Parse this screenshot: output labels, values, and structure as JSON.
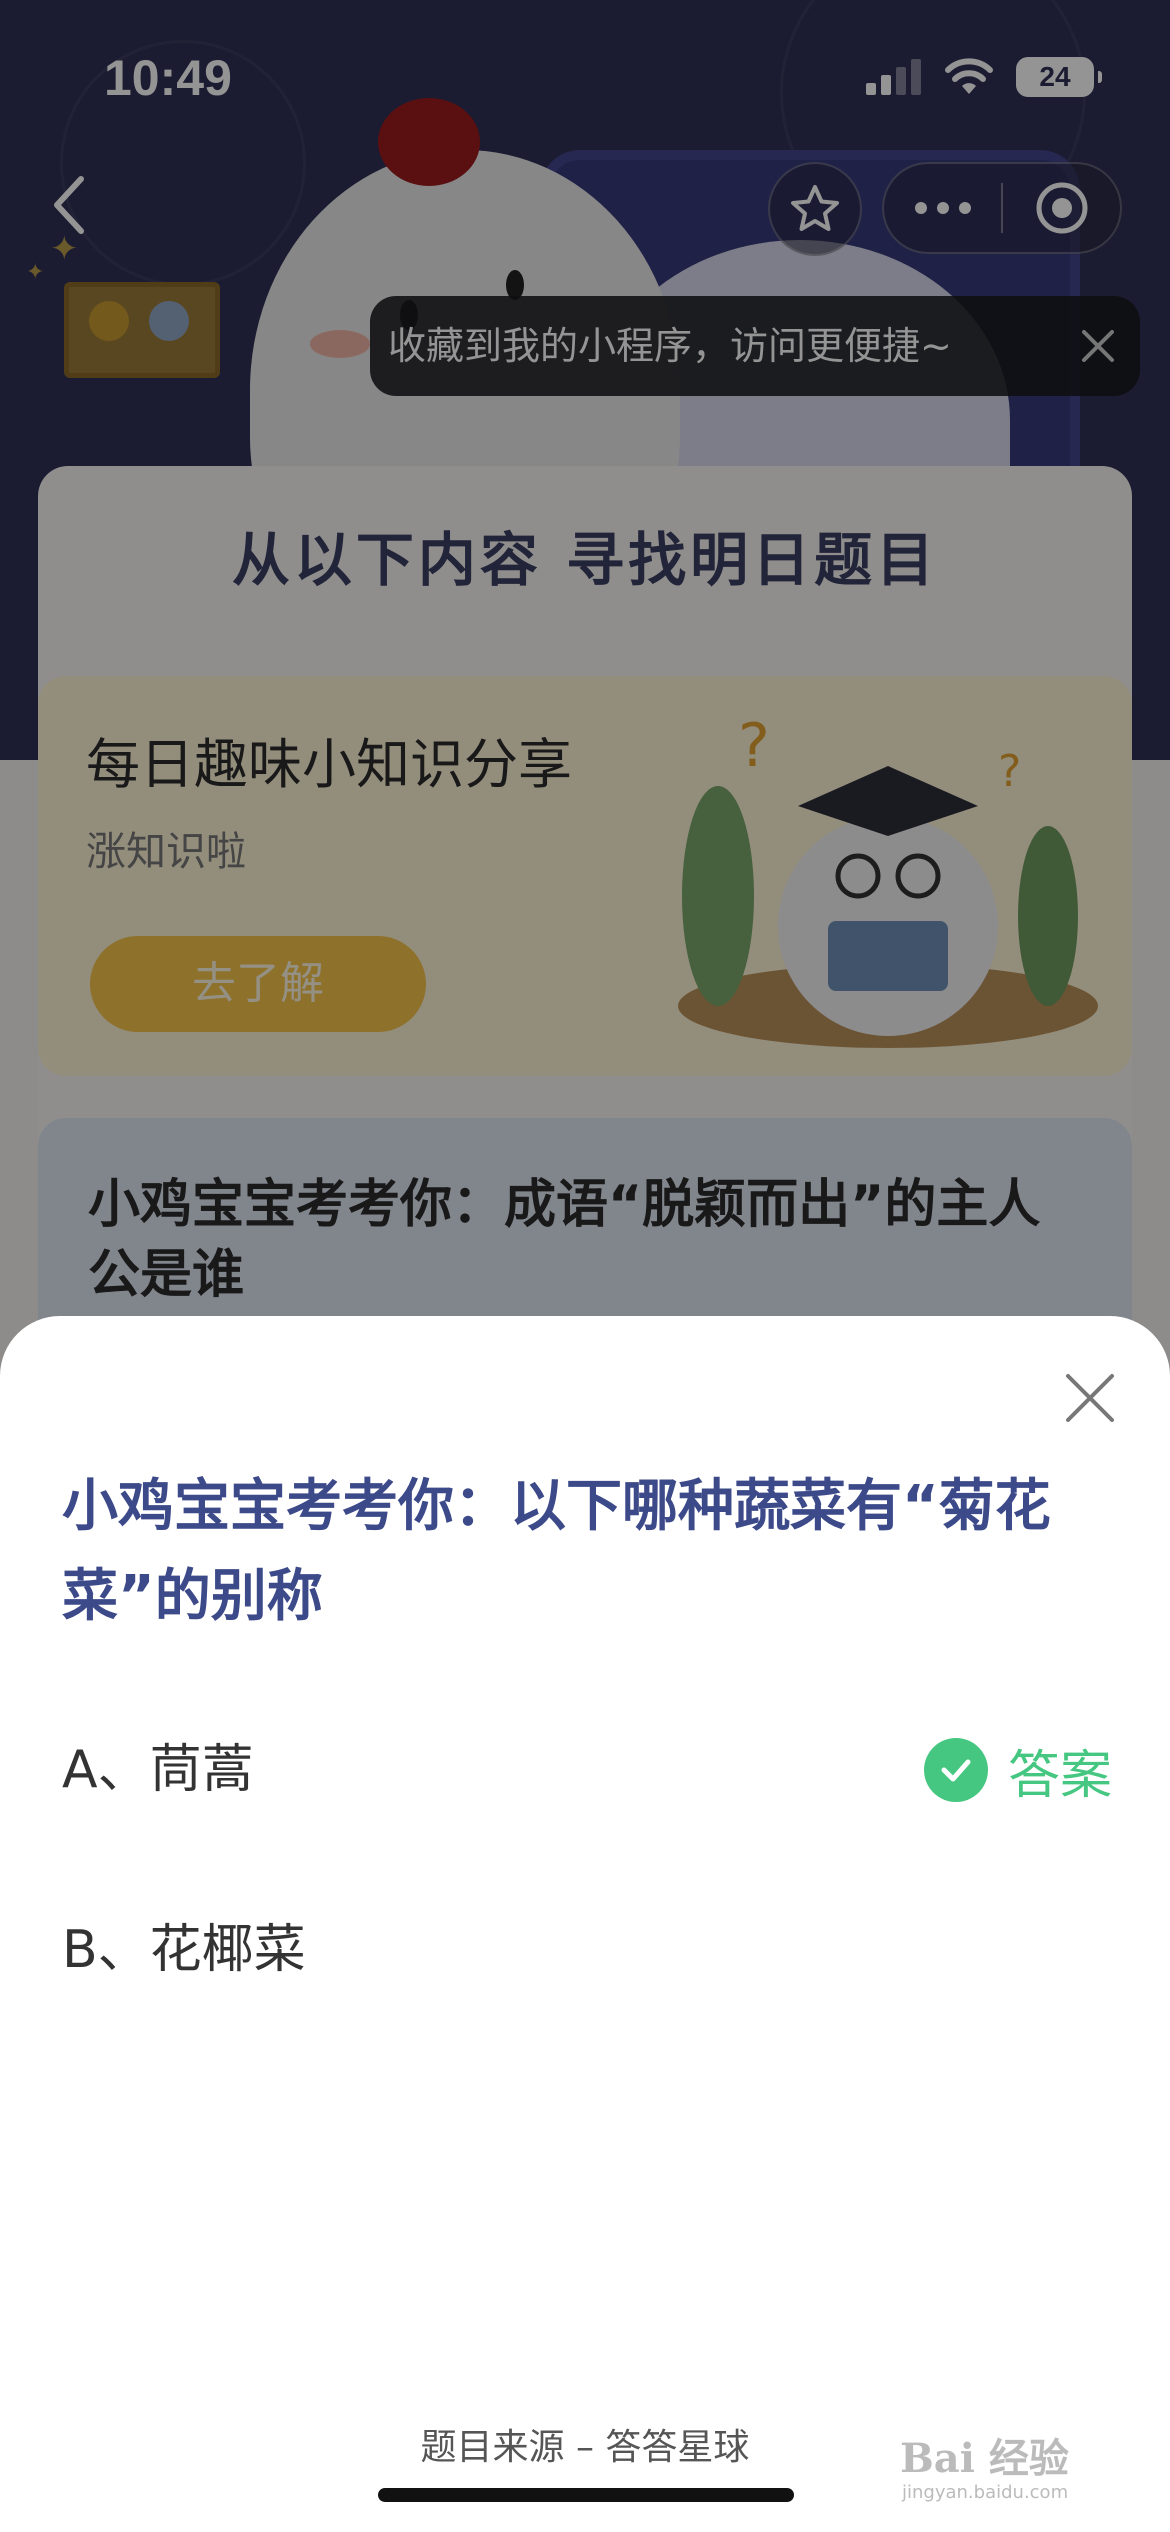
{
  "status_bar": {
    "time": "10:49",
    "battery": "24",
    "signal_icon": "cellular-signal-icon",
    "wifi_icon": "wifi-icon"
  },
  "nav": {
    "back_icon": "chevron-left-icon",
    "favorite_icon": "star-icon",
    "more_icon": "more-dots-icon",
    "close_miniprogram_icon": "target-circle-icon"
  },
  "tooltip": {
    "text": "收藏到我的小程序，访问更便捷~",
    "close_icon": "close-icon"
  },
  "background": {
    "section_title": "从以下内容 寻找明日题目",
    "fact_card": {
      "title": "每日趣味小知识分享",
      "subtitle": "涨知识啦",
      "button": "去了解"
    },
    "question_card": {
      "title": "小鸡宝宝考考你：成语“脱颖而出”的主人公是谁"
    }
  },
  "sheet": {
    "question": "小鸡宝宝考考你：以下哪种蔬菜有“菊花菜”的别称",
    "options": [
      {
        "label": "A、茼蒿",
        "is_answer": true
      },
      {
        "label": "B、花椰菜",
        "is_answer": false
      }
    ],
    "answer_label": "答案",
    "source": "题目来源 – 答答星球",
    "close_icon": "close-icon"
  },
  "watermark": {
    "text": "Bai 经验",
    "sub": "jingyan.baidu.com"
  },
  "colors": {
    "header_bg": "#2f3056",
    "question_text": "#3d4a8a",
    "answer_green": "#45c781",
    "fact_button": "#f4c34a"
  }
}
